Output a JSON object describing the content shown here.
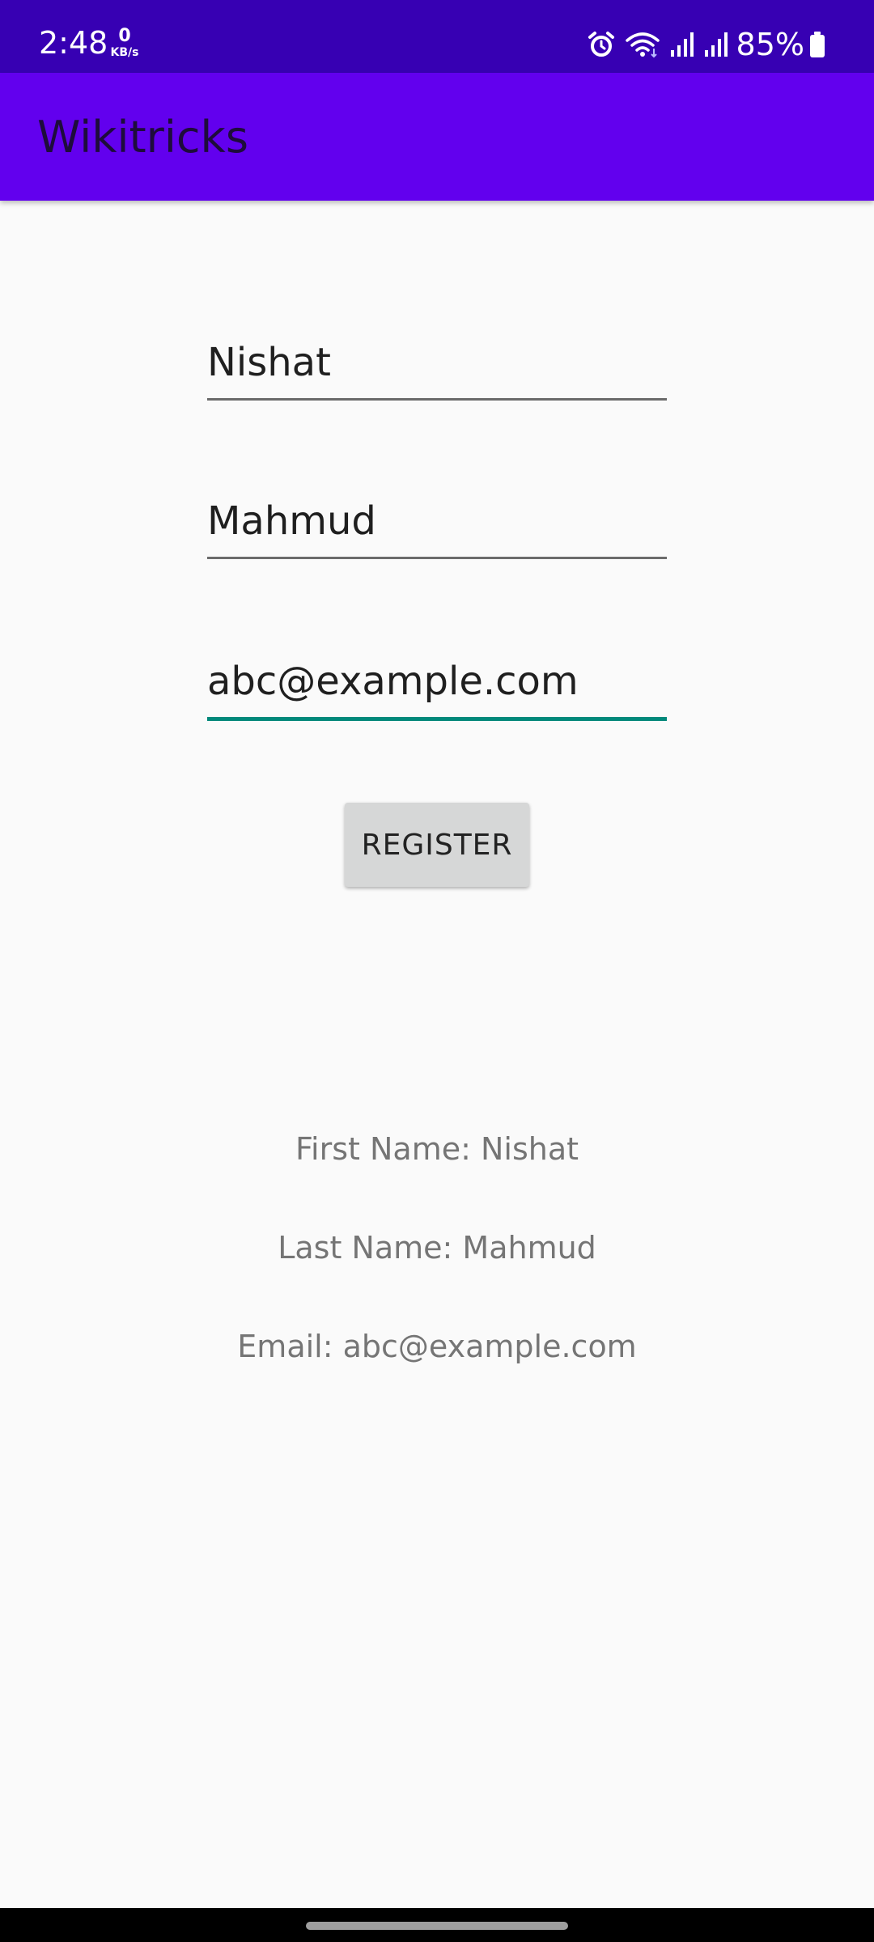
{
  "status_bar": {
    "time": "2:48",
    "net_speed_value": "0",
    "net_speed_unit": "KB/s",
    "battery_percent": "85%",
    "icons": [
      "alarm-icon",
      "wifi-icon",
      "signal-icon",
      "signal-icon",
      "battery-icon"
    ]
  },
  "app_bar": {
    "title": "Wikitricks"
  },
  "form": {
    "first_name_value": "Nishat",
    "last_name_value": "Mahmud",
    "email_value": "abc@example.com",
    "register_label": "REGISTER"
  },
  "results": {
    "first_name_text": "First Name: Nishat",
    "last_name_text": "Last Name: Mahmud",
    "email_text": "Email: abc@example.com"
  },
  "colors": {
    "status_bar": "#3700b3",
    "app_bar": "#6200ee",
    "focused_underline": "#00897b",
    "button": "#d6d7d7",
    "background": "#fafafa"
  }
}
